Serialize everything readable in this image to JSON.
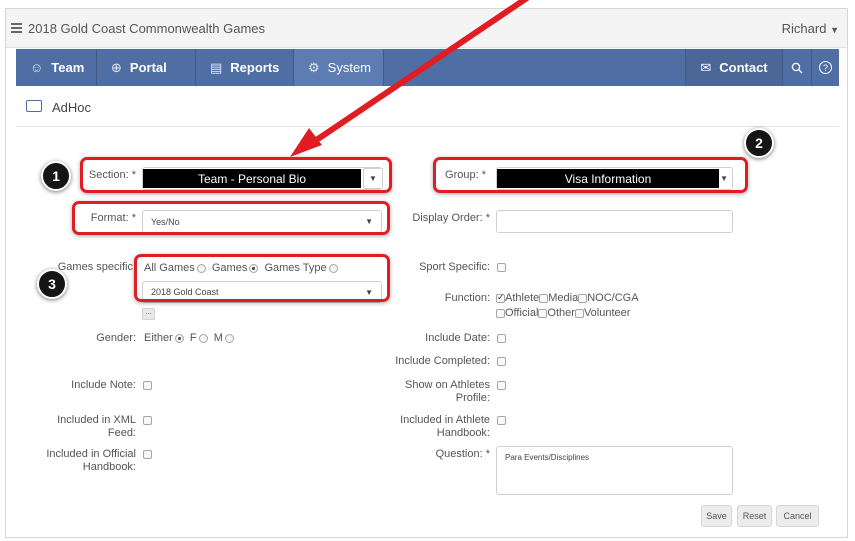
{
  "app": {
    "title": "2018 Gold Coast Commonwealth Games",
    "user": "Richard"
  },
  "nav": {
    "tabs": [
      {
        "label": "Team",
        "icon": "team-icon"
      },
      {
        "label": "Portal",
        "icon": "globe-icon"
      },
      {
        "label": "Reports",
        "icon": "report-icon"
      },
      {
        "label": "System",
        "icon": "gear-icon"
      }
    ],
    "contact": "Contact",
    "help": "?"
  },
  "page": {
    "title": "AdHoc"
  },
  "form": {
    "section": {
      "label": "Section: *",
      "value": "Team - Personal Bio"
    },
    "group": {
      "label": "Group: *",
      "value": "Visa Information"
    },
    "format": {
      "label": "Format: *",
      "value": "Yes/No"
    },
    "display_order": {
      "label": "Display Order: *",
      "value": ""
    },
    "games_specific": {
      "label": "Games specific:",
      "options": [
        "All Games",
        "Games",
        "Games Type"
      ],
      "selected": "Games",
      "value": "2018 Gold Coast",
      "more": "..."
    },
    "sport_specific": {
      "label": "Sport Specific:"
    },
    "function": {
      "label": "Function:",
      "options": [
        "Athlete",
        "Media",
        "NOC/CGA",
        "Official",
        "Other",
        "Volunteer"
      ],
      "checked": [
        "Athlete"
      ]
    },
    "gender": {
      "label": "Gender:",
      "options": [
        "Either",
        "F",
        "M"
      ],
      "selected": "Either"
    },
    "include_date": {
      "label": "Include Date:"
    },
    "include_completed": {
      "label": "Include Completed:"
    },
    "include_note": {
      "label": "Include Note:"
    },
    "show_on_athletes_profile": {
      "label": "Show on Athletes Profile:"
    },
    "included_in_xml_feed": {
      "label": "Included in XML Feed:"
    },
    "included_in_athlete_handbook": {
      "label": "Included in Athlete Handbook:"
    },
    "included_in_official_handbook": {
      "label": "Included in Official Handbook:"
    },
    "question": {
      "label": "Question: *",
      "value": "Para Events/Disciplines"
    }
  },
  "buttons": {
    "save": "Save",
    "reset": "Reset",
    "cancel": "Cancel"
  },
  "annotations": {
    "badges": [
      "1",
      "2",
      "3"
    ],
    "accent": "#e11d24"
  },
  "colors": {
    "nav": "#4f6ea4",
    "nav_active": "#5d7cb1"
  }
}
